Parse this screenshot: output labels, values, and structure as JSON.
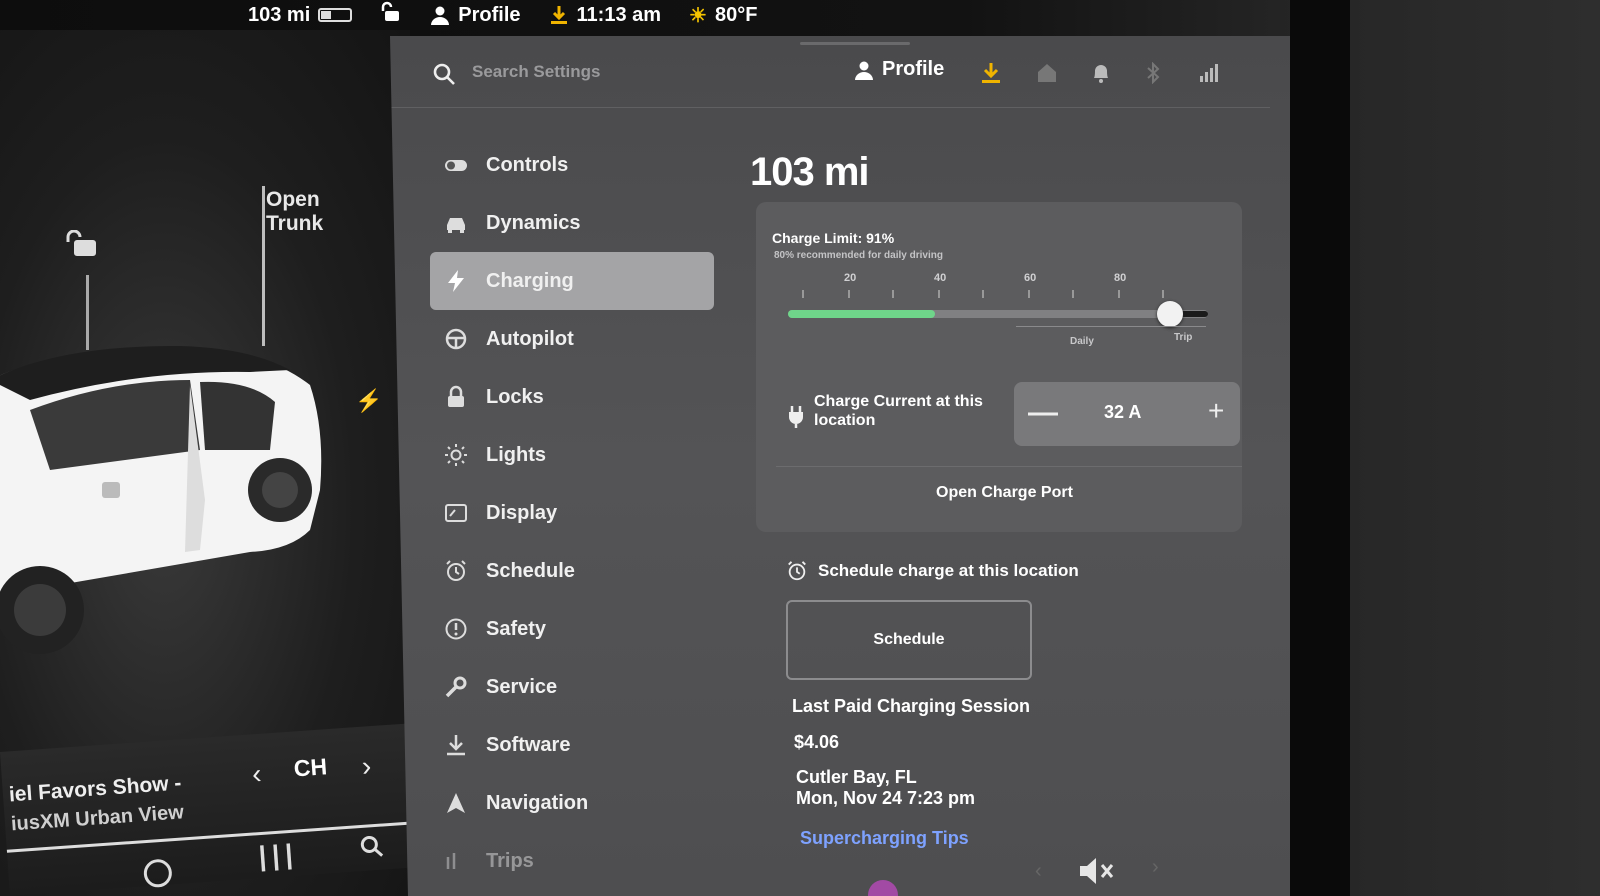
{
  "status_bar": {
    "range": "103 mi",
    "profile": "Profile",
    "time": "11:13 am",
    "temperature": "80°F"
  },
  "vehicle": {
    "open_trunk": "Open\nTrunk"
  },
  "media": {
    "title": "iel Favors Show -",
    "subtitle": "iusXM Urban View",
    "channel": "CH",
    "prev": "‹",
    "next": "›"
  },
  "settings": {
    "search_placeholder": "Search Settings",
    "profile_label": "Profile",
    "nav": [
      {
        "label": "Controls",
        "icon": "toggle-icon"
      },
      {
        "label": "Dynamics",
        "icon": "car-icon"
      },
      {
        "label": "Charging",
        "icon": "bolt-icon",
        "active": true
      },
      {
        "label": "Autopilot",
        "icon": "steering-wheel-icon"
      },
      {
        "label": "Locks",
        "icon": "lock-icon"
      },
      {
        "label": "Lights",
        "icon": "sun-icon"
      },
      {
        "label": "Display",
        "icon": "display-icon"
      },
      {
        "label": "Schedule",
        "icon": "alarm-clock-icon"
      },
      {
        "label": "Safety",
        "icon": "alert-circle-icon"
      },
      {
        "label": "Service",
        "icon": "wrench-icon"
      },
      {
        "label": "Software",
        "icon": "download-icon"
      },
      {
        "label": "Navigation",
        "icon": "navigation-icon"
      },
      {
        "label": "Trips",
        "icon": "trips-icon"
      }
    ]
  },
  "charging": {
    "range": "103 mi",
    "charge_limit_label": "Charge Limit: 91%",
    "recommendation": "80% recommended for daily driving",
    "charge_limit_percent": 91,
    "current_level_percent": 35,
    "scale_labels": [
      "20",
      "40",
      "60",
      "80"
    ],
    "zone_daily": "Daily",
    "zone_trip": "Trip",
    "charge_current_label": "Charge Current at this location",
    "charge_current_value": "32 A",
    "minus": "—",
    "plus": "+",
    "open_charge_port": "Open Charge Port",
    "schedule_label": "Schedule charge at this location",
    "schedule_button": "Schedule",
    "last_session_title": "Last Paid Charging Session",
    "last_session_amount": "$4.06",
    "last_session_location": "Cutler Bay, FL",
    "last_session_date": "Mon, Nov 24 7:23 pm",
    "tips_link": "Supercharging Tips"
  },
  "colors": {
    "panel": "#525254",
    "active_nav": "#a4a4a6",
    "charge_fill": "#6fd58a",
    "link": "#7ea2ff",
    "download_accent": "#f0b400"
  }
}
